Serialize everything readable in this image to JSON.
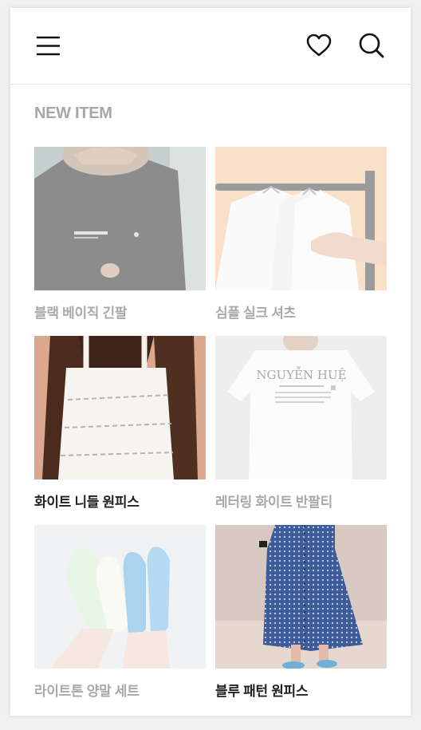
{
  "header": {
    "menu_icon": "hamburger-menu-icon",
    "wishlist_icon": "heart-icon",
    "search_icon": "search-icon"
  },
  "section": {
    "title": "NEW ITEM"
  },
  "products": [
    {
      "name": "블랙 베이직 긴팔",
      "state": "dimmed"
    },
    {
      "name": "심플 실크 셔츠",
      "state": "dimmed"
    },
    {
      "name": "화이트 니들 원피스",
      "state": "active"
    },
    {
      "name": "레터링 화이트 반팔티",
      "state": "dimmed",
      "print_text": "NGUYỄN HUỆ"
    },
    {
      "name": "라이트톤 양말 세트",
      "state": "dimmed"
    },
    {
      "name": "블루 패턴 원피스",
      "state": "active"
    }
  ],
  "colors": {
    "dimmed_text": "#a9a9a9",
    "active_text": "#222222",
    "title_text": "#a7a7a7"
  }
}
